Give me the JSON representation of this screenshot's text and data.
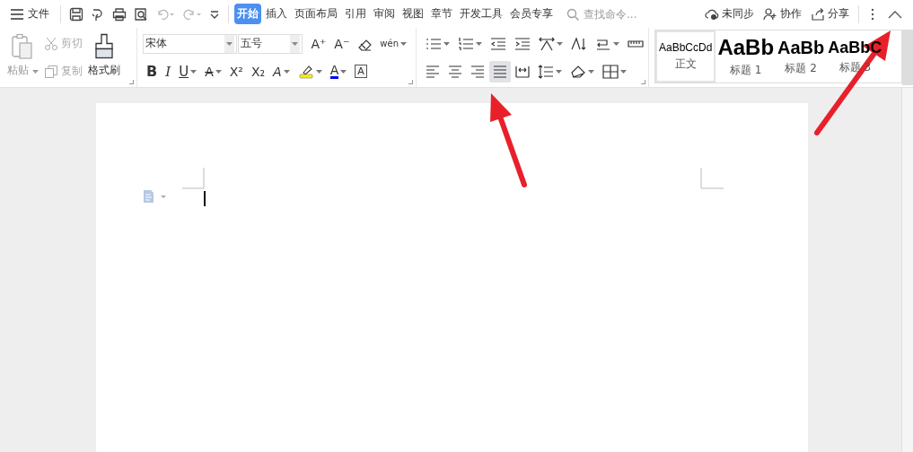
{
  "menu": {
    "label": "文件"
  },
  "quick_access": [
    {
      "kind": "save",
      "disabled": false
    },
    {
      "kind": "export",
      "disabled": false
    },
    {
      "kind": "print",
      "disabled": false
    },
    {
      "kind": "preview",
      "disabled": false
    },
    {
      "kind": "undo",
      "disabled": true
    },
    {
      "kind": "redo",
      "disabled": true
    },
    {
      "kind": "customize",
      "disabled": false
    }
  ],
  "tabs": [
    {
      "label": "开始",
      "selected": true
    },
    {
      "label": "插入",
      "selected": false
    },
    {
      "label": "页面布局",
      "selected": false
    },
    {
      "label": "引用",
      "selected": false
    },
    {
      "label": "审阅",
      "selected": false
    },
    {
      "label": "视图",
      "selected": false
    },
    {
      "label": "章节",
      "selected": false
    },
    {
      "label": "开发工具",
      "selected": false
    },
    {
      "label": "会员专享",
      "selected": false
    }
  ],
  "search": {
    "placeholder": "查找命令..."
  },
  "actions": [
    {
      "kind": "cloud",
      "label": "未同步"
    },
    {
      "kind": "user",
      "label": "协作"
    },
    {
      "kind": "share",
      "label": "分享"
    }
  ],
  "clipboard": {
    "paste": {
      "label": "粘贴",
      "disabled": true
    },
    "cut": {
      "label": "剪切",
      "disabled": true
    },
    "copy": {
      "label": "复制",
      "disabled": true
    },
    "painter": {
      "label": "格式刷",
      "disabled": false
    }
  },
  "font": {
    "family": "宋体",
    "size": "五号"
  },
  "font_tools": [
    {
      "kind": "grow",
      "label": "A⁺"
    },
    {
      "kind": "shrink",
      "label": "A⁻"
    },
    {
      "kind": "clear"
    },
    {
      "kind": "pinyin",
      "label": "wén"
    }
  ],
  "format_tools": [
    {
      "kind": "bold",
      "label": "B"
    },
    {
      "kind": "italic",
      "label": "I"
    },
    {
      "kind": "underline",
      "label": "U"
    },
    {
      "kind": "strike",
      "label": "A"
    },
    {
      "kind": "sup",
      "label": "X²"
    },
    {
      "kind": "sub",
      "label": "X₂"
    },
    {
      "kind": "effect",
      "label": "A"
    },
    {
      "kind": "highlight"
    },
    {
      "kind": "fontcolor",
      "label": "A"
    },
    {
      "kind": "border",
      "label": "A"
    }
  ],
  "paragraph_row1": [
    {
      "kind": "bullets"
    },
    {
      "kind": "numbers"
    },
    {
      "kind": "outdent"
    },
    {
      "kind": "indent"
    },
    {
      "kind": "direction"
    },
    {
      "kind": "sort"
    },
    {
      "kind": "linebreak"
    },
    {
      "kind": "ruler"
    }
  ],
  "alignment": [
    {
      "kind": "left",
      "selected": false
    },
    {
      "kind": "center",
      "selected": false
    },
    {
      "kind": "right",
      "selected": false
    },
    {
      "kind": "justify",
      "selected": true
    },
    {
      "kind": "distribute",
      "selected": false
    }
  ],
  "paragraph_row2": [
    {
      "kind": "spacing"
    },
    {
      "kind": "shading"
    },
    {
      "kind": "borders"
    }
  ],
  "styles": [
    {
      "preview": "AaBbCcDd",
      "name": "正文",
      "kind": "body",
      "selected": true
    },
    {
      "preview": "AaBb",
      "name": "标题 1",
      "kind": "h1",
      "selected": false
    },
    {
      "preview": "AaBb",
      "name": "标题 2",
      "kind": "h2",
      "selected": false
    },
    {
      "preview": "AaBbC",
      "name": "标题 3",
      "kind": "h3",
      "selected": false
    }
  ],
  "annotations": [
    {
      "kind": "arrow",
      "color": "#e8202a"
    },
    {
      "kind": "arrow",
      "color": "#e8202a"
    }
  ]
}
